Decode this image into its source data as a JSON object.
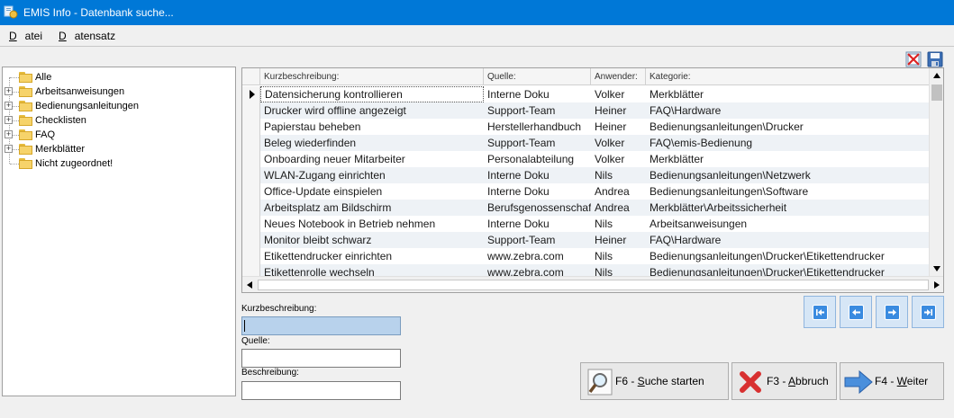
{
  "window": {
    "title": "EMIS Info - Datenbank suche..."
  },
  "menu": {
    "file": "Datei",
    "record": "Datensatz"
  },
  "tree": {
    "items": [
      {
        "label": "Alle",
        "expandable": false
      },
      {
        "label": "Arbeitsanweisungen",
        "expandable": true
      },
      {
        "label": "Bedienungsanleitungen",
        "expandable": true
      },
      {
        "label": "Checklisten",
        "expandable": true
      },
      {
        "label": "FAQ",
        "expandable": true
      },
      {
        "label": "Merkblätter",
        "expandable": true
      },
      {
        "label": "Nicht zugeordnet!",
        "expandable": false
      }
    ]
  },
  "grid": {
    "columns": [
      "Kurzbeschreibung:",
      "Quelle:",
      "Anwender:",
      "Kategorie:"
    ],
    "rows": [
      [
        "Datensicherung kontrollieren",
        "Interne Doku",
        "Volker",
        "Merkblätter"
      ],
      [
        "Drucker wird offline angezeigt",
        "Support-Team",
        "Heiner",
        "FAQ\\Hardware"
      ],
      [
        "Papierstau beheben",
        "Herstellerhandbuch",
        "Heiner",
        "Bedienungsanleitungen\\Drucker"
      ],
      [
        "Beleg wiederfinden",
        "Support-Team",
        "Volker",
        "FAQ\\emis-Bedienung"
      ],
      [
        "Onboarding neuer Mitarbeiter",
        "Personalabteilung",
        "Volker",
        "Merkblätter"
      ],
      [
        "WLAN-Zugang einrichten",
        "Interne Doku",
        "Nils",
        "Bedienungsanleitungen\\Netzwerk"
      ],
      [
        "Office-Update einspielen",
        "Interne Doku",
        "Andrea",
        "Bedienungsanleitungen\\Software"
      ],
      [
        "Arbeitsplatz am Bildschirm",
        "Berufsgenossenschaft",
        "Andrea",
        "Merkblätter\\Arbeitssicherheit"
      ],
      [
        "Neues Notebook in Betrieb nehmen",
        "Interne Doku",
        "Nils",
        "Arbeitsanweisungen"
      ],
      [
        "Monitor bleibt schwarz",
        "Support-Team",
        "Heiner",
        "FAQ\\Hardware"
      ],
      [
        "Etikettendrucker einrichten",
        "www.zebra.com",
        "Nils",
        "Bedienungsanleitungen\\Drucker\\Etikettendrucker"
      ],
      [
        "Etikettenrolle wechseln",
        "www.zebra.com",
        "Nils",
        "Bedienungsanleitungen\\Drucker\\Etikettendrucker"
      ]
    ],
    "selected_row": 0
  },
  "form": {
    "short_label": "Kurzbeschreibung:",
    "short_value": "",
    "source_label": "Quelle:",
    "source_value": "",
    "desc_label": "Beschreibung:",
    "desc_value": ""
  },
  "buttons": {
    "search": {
      "key": "F6 - ",
      "mnemonic": "S",
      "rest": "uche starten"
    },
    "cancel": {
      "key": "F3 - ",
      "mnemonic": "A",
      "rest": "bbruch"
    },
    "next": {
      "key": "F4 - ",
      "mnemonic": "W",
      "rest": "eiter"
    }
  },
  "nav": [
    "first-record-icon",
    "prev-record-icon",
    "next-record-icon",
    "last-record-icon"
  ],
  "toolbar": [
    "delete-icon",
    "save-icon"
  ],
  "colors": {
    "titlebar": "#0078d7",
    "selection": "#b8d2ec",
    "nav": "#3a8be0"
  }
}
